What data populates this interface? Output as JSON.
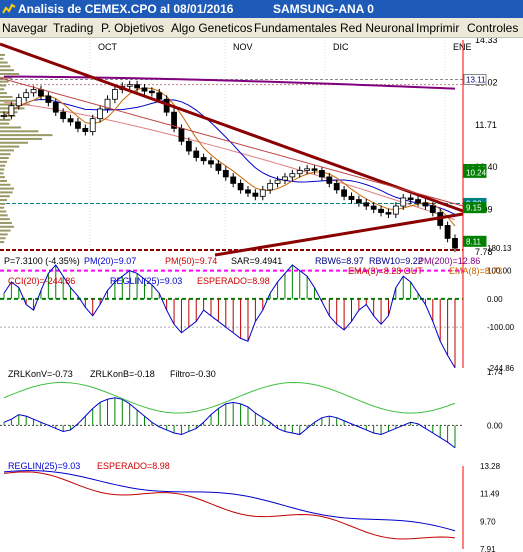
{
  "window": {
    "title": "Analisis de CEMEX.CPO al 08/01/2016",
    "subtitle": "SAMSUNG-ANA 0"
  },
  "menu": [
    "Navegar",
    "Trading",
    "P. Objetivos",
    "Algo Geneticos",
    "Fundamentales",
    "Red Neuronal",
    "Imprimir",
    "Controles"
  ],
  "colors": {
    "titlebar": "#1e5ab8",
    "menubar": "#ece9d8",
    "candle_up": "#ffffff",
    "candle_down": "#000000",
    "trend": "#8b0000",
    "pm20": "#0000cc",
    "pm50": "#cc6600",
    "pm200": "#800080",
    "volume_profile": "#999966",
    "macd_green": "#008000"
  },
  "chart_data": [
    {
      "type": "candlestick",
      "panel": "price",
      "months": [
        "OCT",
        "NOV",
        "DIC",
        "ENE"
      ],
      "yticks": [
        "14.33",
        "13.02",
        "11.71",
        "10.40",
        "9.09",
        "7.78"
      ],
      "ylim": [
        7.78,
        14.33
      ],
      "close": [
        12.0,
        12.3,
        12.55,
        12.7,
        12.8,
        12.6,
        12.4,
        12.1,
        11.9,
        11.8,
        11.6,
        11.5,
        11.9,
        12.2,
        12.5,
        12.8,
        12.9,
        12.95,
        12.85,
        12.75,
        12.7,
        12.5,
        12.1,
        11.6,
        11.2,
        10.9,
        10.7,
        10.6,
        10.5,
        10.3,
        10.1,
        9.9,
        9.7,
        9.6,
        9.5,
        9.7,
        9.9,
        10.0,
        10.1,
        10.2,
        10.3,
        10.35,
        10.3,
        10.1,
        9.9,
        9.7,
        9.5,
        9.4,
        9.3,
        9.2,
        9.1,
        9.0,
        8.95,
        9.2,
        9.45,
        9.4,
        9.3,
        9.2,
        9.0,
        8.6,
        8.2,
        7.9
      ],
      "price_tags": [
        {
          "text": "13.11",
          "value": 13.11,
          "bg": "#ffffff",
          "fg": "#000080"
        },
        {
          "text": "10.33",
          "value": 10.33,
          "bg": "#008000",
          "fg": "#ffffff"
        },
        {
          "text": "10.24",
          "value": 10.24,
          "bg": "#008000",
          "fg": "#ffffff"
        },
        {
          "text": "9.28",
          "value": 9.28,
          "bg": "#008080",
          "fg": "#ffffff"
        },
        {
          "text": "9.15",
          "value": 9.15,
          "bg": "#008000",
          "fg": "#ffffff"
        },
        {
          "text": "8.11",
          "value": 8.11,
          "bg": "#008000",
          "fg": "#ffffff"
        }
      ],
      "labels": {
        "p": "P=7.3100 (-4.35%)",
        "pm20": "PM(20)=9.07",
        "pm50": "PM(50)=9.74",
        "sar": "SAR=9.4941",
        "rbw6": "RBW6=8.97",
        "rbw10": "RBW10=9.22",
        "pm200": "PM(200)=12.86",
        "ema3": "EMA(3)=8.28 OUT",
        "ema8": "EMA(8)=8.73"
      }
    },
    {
      "type": "bar",
      "panel": "cci",
      "labels": {
        "cci": "CCI(20)=-244.86",
        "reglin": "REGLIN(25)=9.03",
        "esperado": "ESPERADO=8.98"
      },
      "yticks": [
        "180.13",
        "100.00",
        "0.00",
        "-100.00",
        "-244.86"
      ],
      "ylim": [
        -244.86,
        180.13
      ],
      "values": [
        20,
        60,
        40,
        -20,
        -40,
        30,
        90,
        120,
        80,
        40,
        10,
        -30,
        -60,
        -20,
        30,
        60,
        80,
        100,
        90,
        70,
        50,
        20,
        -40,
        -90,
        -120,
        -100,
        -80,
        -40,
        -60,
        -80,
        -100,
        -120,
        -140,
        -150,
        -80,
        -40,
        20,
        60,
        90,
        120,
        100,
        80,
        40,
        -10,
        -60,
        -90,
        -110,
        -80,
        -40,
        -20,
        -60,
        -90,
        -60,
        40,
        80,
        60,
        20,
        -20,
        -80,
        -150,
        -200,
        -244
      ]
    },
    {
      "type": "bar",
      "panel": "zrl",
      "labels": {
        "zrlkonv": "ZRLKonV=-0.73",
        "zrlkonb": "ZRLKonB=-0.18",
        "filtro": "Filtro=-0.30"
      },
      "yticks": [
        "1.74",
        "0.00"
      ],
      "values": [
        0.1,
        0.2,
        0.35,
        0.3,
        0.2,
        0.1,
        0.0,
        -0.1,
        -0.2,
        -0.15,
        0.05,
        0.3,
        0.55,
        0.75,
        0.85,
        0.9,
        0.85,
        0.7,
        0.5,
        0.3,
        0.1,
        -0.05,
        -0.15,
        -0.25,
        -0.3,
        -0.2,
        -0.1,
        0.1,
        0.35,
        0.55,
        0.7,
        0.75,
        0.7,
        0.6,
        0.4,
        0.25,
        0.1,
        -0.1,
        -0.2,
        -0.25,
        -0.3,
        -0.1,
        0.1,
        0.25,
        0.3,
        0.25,
        0.15,
        0.05,
        -0.05,
        -0.15,
        -0.25,
        -0.3,
        -0.2,
        -0.1,
        0.0,
        0.1,
        0.05,
        -0.1,
        -0.25,
        -0.4,
        -0.55,
        -0.73
      ]
    },
    {
      "type": "line",
      "panel": "reglin",
      "labels": {
        "reglin": "REGLIN(25)=9.03",
        "esperado": "ESPERADO=8.98"
      },
      "yticks": [
        "13.28",
        "11.49",
        "9.70",
        "7.91"
      ],
      "ylim": [
        7.91,
        13.28
      ]
    }
  ]
}
